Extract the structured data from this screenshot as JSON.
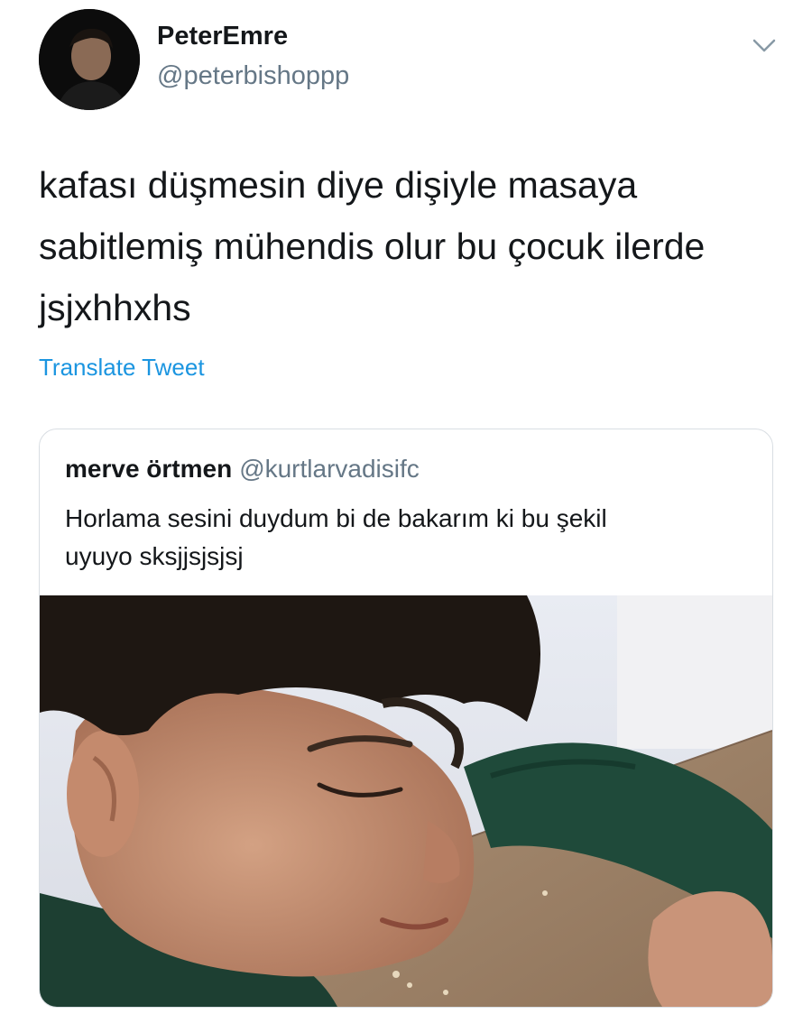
{
  "tweet": {
    "author": {
      "display_name": "PeterEmre",
      "handle": "@peterbishoppp"
    },
    "text_lines": [
      "kafası düşmesin diye dişiyle masaya",
      "sabitlemiş mühendis olur bu çocuk ilerde",
      "jsjxhhxhs"
    ],
    "translate_label": "Translate Tweet",
    "menu_icon": "chevron-down-icon",
    "link_color": "#1b95e0"
  },
  "quoted_tweet": {
    "author": {
      "display_name": "merve örtmen",
      "handle": "@kurtlarvadisifc"
    },
    "text_lines": [
      "Horlama sesini duydum bi de bakarım ki bu şekil",
      "uyuyo sksjjsjsjsj"
    ],
    "media": "photo of a sleeping child resting head on a table"
  }
}
